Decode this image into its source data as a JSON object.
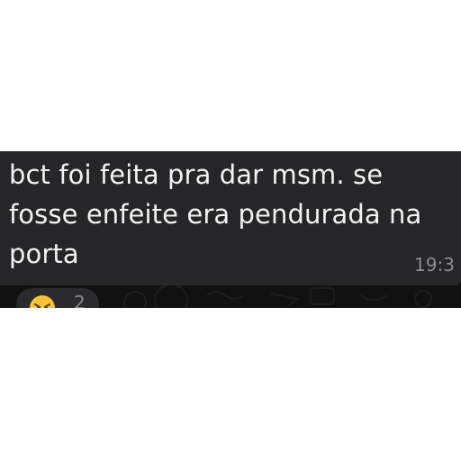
{
  "message": {
    "lines": [
      "bct foi feita pra dar msm. se",
      "fosse enfeite era pendurada na",
      "porta"
    ],
    "time": "19:3",
    "bubble_color": "#252627",
    "text_color": "#f2f2f2"
  },
  "reaction": {
    "emoji_icon": "grinning-squinting-face-icon",
    "count": "2"
  },
  "background_color": "#111111"
}
